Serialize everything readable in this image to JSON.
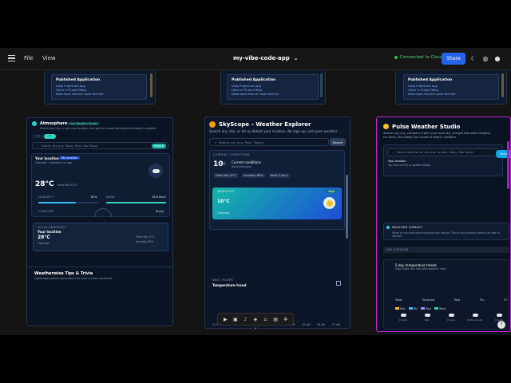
{
  "topbar": {
    "file_menu": "File",
    "view_menu": "View",
    "app_title": "my-vibe-code-app",
    "connection_status": "Connected to Cloud AI",
    "share_label": "Share"
  },
  "published": {
    "heading": "Published Application",
    "links": [
      "View Published App",
      "Open in Pulse Editor",
      "Download Source Code Archive"
    ]
  },
  "card1": {
    "title": "Atmosphere",
    "badge": "Live Weather Studio",
    "subtitle": "Search any city, or use your location, and get rich mood tips tailored to today's weather.",
    "unit_c": "°C",
    "unit_f": "°F",
    "search_placeholder": "Search city (e.g. Tokyo, Paris, São Paulo)",
    "search_button": "Search",
    "location_title": "Your location",
    "location_badge": "My location",
    "location_sub": "Overcast • Updated 1m ago",
    "temp": "28°C",
    "feels": "Feels like 31°C",
    "humidity_label": "HUMIDITY",
    "humidity_value": "62%",
    "wind_label": "WIND",
    "wind_value": "16.8 km/h",
    "comfort_label": "COMFORT",
    "comfort_value": "Sticky",
    "snapshot_label": "LOCAL SNAPSHOT",
    "snapshot_title": "Your location",
    "snapshot_temp": "28°C",
    "snapshot_desc": "Overcast",
    "snapshot_right1": "Feels like 31°C",
    "snapshot_right2": "Humidity 62%",
    "tips_title": "Weatherwise Tips & Trivia",
    "tips_sub": "Lightweight advice generated from your current conditions."
  },
  "card2": {
    "title": "SkyScope – Weather Explorer",
    "subtitle": "Search any city, or let us detect your location. No sign-up, just pure weather.",
    "search_placeholder": "Search city (e.g. Paris, Tokyo)",
    "search_button": "Search",
    "section_label": "CURRENT CONDITIONS",
    "temp": "10",
    "unit": "°C",
    "cond_title": "Current conditions",
    "cond_city": "Asia/Shanghai",
    "chip1": "Feels like 10°C",
    "chip2": "Humidity 80%",
    "chip3": "Wind 3 km/h",
    "snap_label": "SNAPSHOT",
    "snap_badge": "Now",
    "snap_temp": "10°C",
    "snap_desc": "Overcast",
    "next_label": "NEXT HOURS",
    "trend_title": "Temperature trend",
    "times": [
      "11 PM",
      "12 AM",
      "01 AM",
      "02 AM",
      "03 AM",
      "04 AM",
      "05 AM",
      "06 AM",
      "07 AM"
    ]
  },
  "card3": {
    "title": "Pulse Weather Studio",
    "title_tag": "live",
    "subtitle": "Search any city, compare it with your local sky, and get bite-sized insights, fun facts, and safety tips tuned to today's weather.",
    "search_placeholder": "Search weather by city (e.g. London, Tokyo, São Paulo)",
    "search_button": "Search",
    "loc_title": "Your location",
    "loc_sub": "Tap Use current to update details.",
    "funfact_title": "WEATHER FUNFACT",
    "funfact_text": "Warm air can hold more moisture than cold air. That is why summer storms can feel so intense.",
    "section_label": "24H OUTLOOK",
    "forecast_title": "5-day temperature trends",
    "forecast_sub": "Daily highs and lows with weather icons",
    "legend": [
      "Max",
      "Min",
      "Rain",
      "Wind"
    ],
    "days": [
      "Today",
      "Tomorrow",
      "Wed",
      "Thu",
      "Fri"
    ],
    "day_conditions": [
      "Cloudy",
      "Rain",
      "Cloudy",
      "Partly cloudy",
      "Cloudy"
    ]
  },
  "toolbar_icons": [
    "play-icon",
    "image-icon",
    "mic-icon",
    "layers-icon",
    "home-icon",
    "window-icon",
    "settings-icon"
  ],
  "colors": {
    "accent": "#2563eb",
    "connected": "#22c55e",
    "card3_border": "#c026d3",
    "gradient_start": "#14b8a6",
    "gradient_end": "#1e3a8a"
  }
}
